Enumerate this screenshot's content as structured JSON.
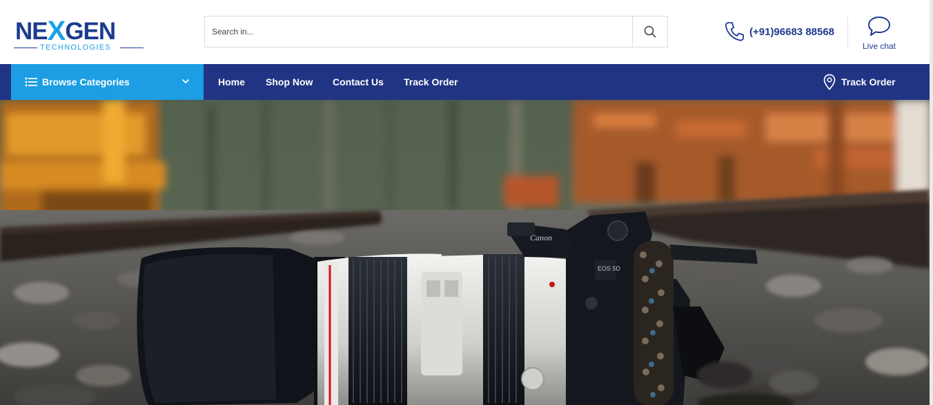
{
  "header": {
    "logo": {
      "main_left": "NE",
      "main_x": "X",
      "main_right": "GEN",
      "tagline": "TECHNOLOGIES"
    },
    "search": {
      "placeholder": "Search in...",
      "value": "",
      "icon": "search-icon"
    },
    "phone": {
      "icon": "phone-icon",
      "number": "(+91)96683 88568"
    },
    "live_chat": {
      "icon": "chat-bubble-icon",
      "label": "Live chat"
    }
  },
  "nav": {
    "browse": {
      "icon": "list-icon",
      "label": "Browse Categories",
      "chevron": "chevron-down-icon"
    },
    "links": [
      {
        "label": "Home"
      },
      {
        "label": "Shop Now"
      },
      {
        "label": "Contact Us"
      },
      {
        "label": "Track Order"
      }
    ],
    "track_order_right": {
      "icon": "map-pin-icon",
      "label": "Track Order"
    }
  },
  "hero": {
    "image": "camera-on-railway-tracks-photo",
    "camera_brand_text": "Canon",
    "camera_model_text": "EOS 5D"
  },
  "colors": {
    "brand_navy": "#213483",
    "brand_blue": "#1d9ee4",
    "logo_navy": "#1d3b8f",
    "logo_cyan": "#1aa0e6"
  }
}
